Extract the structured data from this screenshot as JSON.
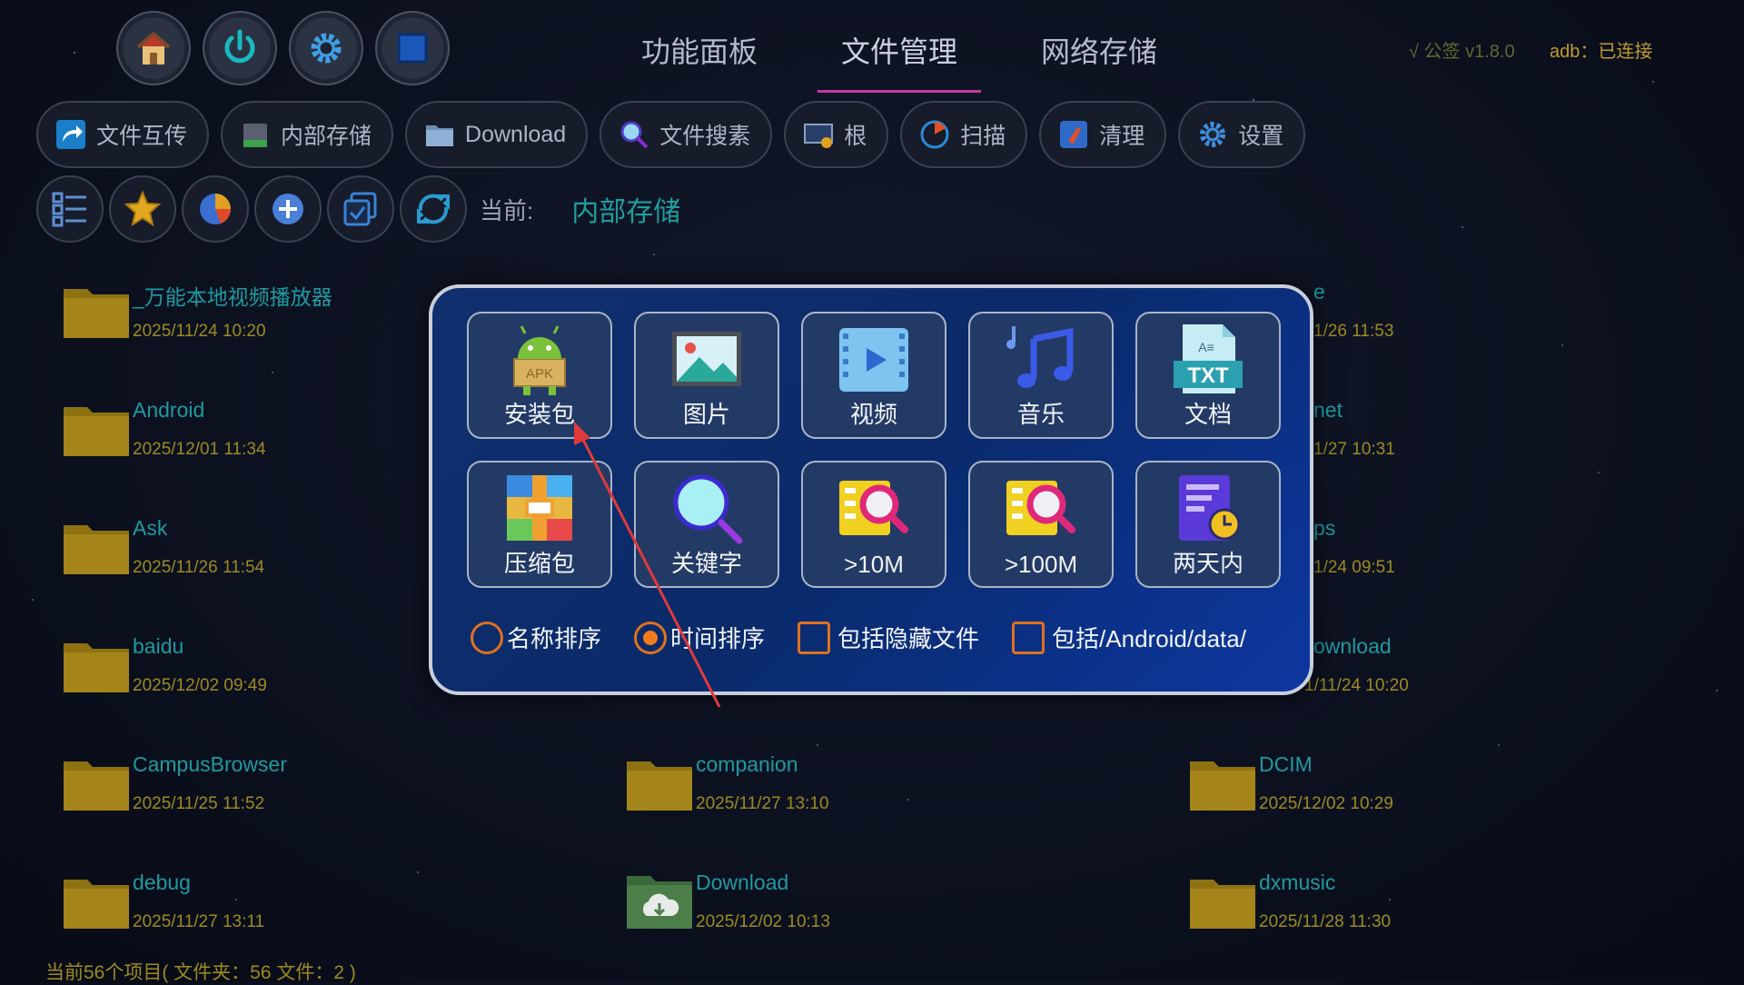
{
  "top_icons": [
    "home-icon",
    "power-icon",
    "gear-icon",
    "window-icon"
  ],
  "tabs": [
    {
      "label": "功能面板",
      "active": false
    },
    {
      "label": "文件管理",
      "active": true
    },
    {
      "label": "网络存储",
      "active": false
    }
  ],
  "version": "√ 公签 v1.8.0",
  "adb_status": "adb：已连接",
  "toolbar": [
    {
      "label": "文件互传",
      "icon": "share-icon"
    },
    {
      "label": "内部存储",
      "icon": "storage-icon"
    },
    {
      "label": "Download",
      "icon": "folder-icon"
    },
    {
      "label": "文件搜素",
      "icon": "search-icon"
    },
    {
      "label": "根",
      "icon": "root-icon"
    },
    {
      "label": "扫描",
      "icon": "scan-icon"
    },
    {
      "label": "清理",
      "icon": "clean-icon"
    },
    {
      "label": "设置",
      "icon": "gear-icon"
    }
  ],
  "row2_icons": [
    "list-icon",
    "star-icon",
    "pie-chart-icon",
    "plus-icon",
    "multi-select-icon",
    "refresh-icon"
  ],
  "current": {
    "label": "当前:",
    "path": "内部存储"
  },
  "files": [
    {
      "name": "_万能本地视频播放器",
      "date": "2025/11/24 10:20"
    },
    {
      "name": "Android",
      "date": "2025/12/01 11:34"
    },
    {
      "name": "Ask",
      "date": "2025/11/26 11:54"
    },
    {
      "name": "baidu",
      "date": "2025/12/02 09:49"
    },
    {
      "name": "CampusBrowser",
      "date": "2025/11/25 11:52"
    },
    {
      "name": "debug",
      "date": "2025/11/27 13:11"
    },
    {
      "name": "companion",
      "date": "2025/11/27 13:10"
    },
    {
      "name": "Download",
      "date": "2025/12/02 10:13"
    },
    {
      "name": "DCIM",
      "date": "2025/12/02 10:29"
    },
    {
      "name": "dxmusic",
      "date": "2025/11/28 11:30"
    }
  ],
  "partial_right": [
    {
      "name": "e",
      "date": "1/26 11:53"
    },
    {
      "name": "net",
      "date": "1/27 10:31"
    },
    {
      "name": "ps",
      "date": "1/24 09:51"
    },
    {
      "name": "ownload",
      "date": "1/11/24 10:20"
    }
  ],
  "status_text": "当前56个项目( 文件夹：56  文件：2 )",
  "dialog": {
    "categories": [
      {
        "label": "安装包",
        "icon": "apk-icon"
      },
      {
        "label": "图片",
        "icon": "image-icon"
      },
      {
        "label": "视频",
        "icon": "video-icon"
      },
      {
        "label": "音乐",
        "icon": "music-icon"
      },
      {
        "label": "文档",
        "icon": "txt-document-icon"
      },
      {
        "label": "压缩包",
        "icon": "archive-icon"
      },
      {
        "label": "关键字",
        "icon": "magnifier-icon"
      },
      {
        "label": ">10M",
        "icon": "large-file-search-icon"
      },
      {
        "label": ">100M",
        "icon": "huge-file-search-icon"
      },
      {
        "label": "两天内",
        "icon": "recent-doc-icon"
      }
    ],
    "apk_badge": "APK",
    "txt_badge": "TXT",
    "options": [
      {
        "label": "名称排序",
        "type": "radio",
        "checked": false
      },
      {
        "label": "时间排序",
        "type": "radio",
        "checked": true
      },
      {
        "label": "包括隐藏文件",
        "type": "checkbox",
        "checked": false
      },
      {
        "label": "包括/Android/data/",
        "type": "checkbox",
        "checked": false
      }
    ]
  },
  "colors": {
    "accent_tab": "#c23aa0",
    "file_name": "#1e9aa0",
    "file_date": "#9e8a22",
    "dialog_bg": "#0c37a0",
    "option_orange": "#f07a1c"
  }
}
